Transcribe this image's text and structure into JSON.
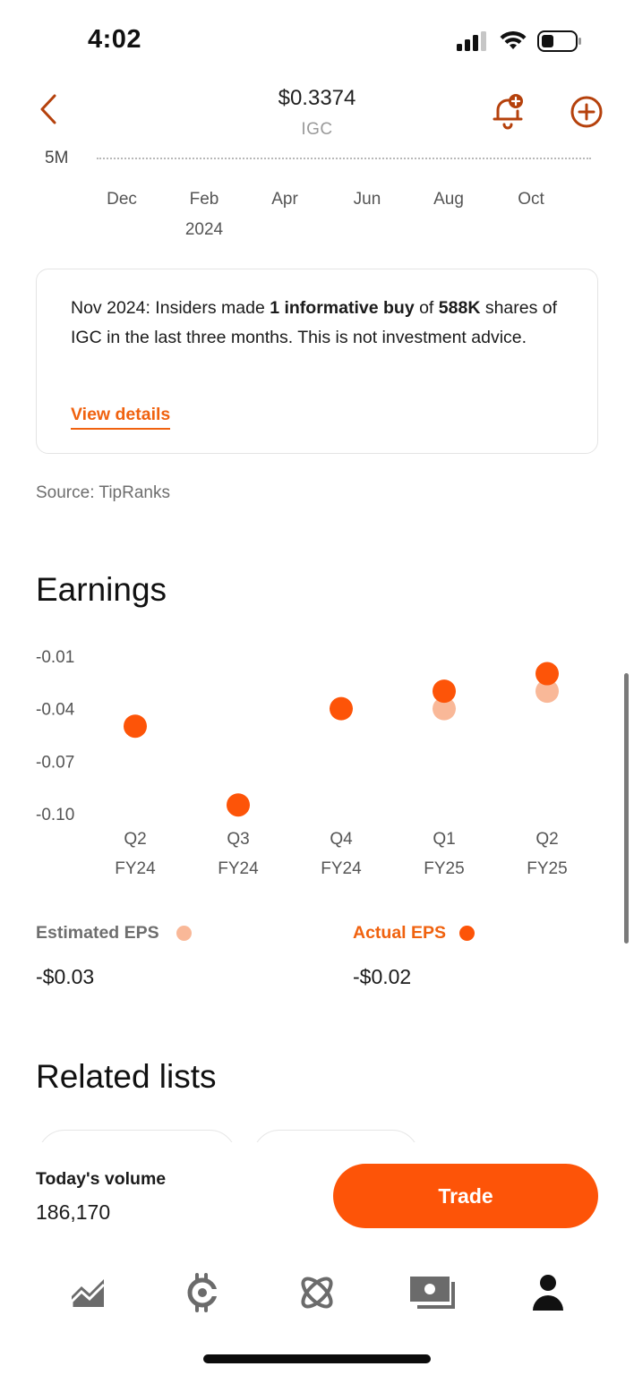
{
  "status_bar": {
    "time": "4:02"
  },
  "header": {
    "price": "$0.3374",
    "ticker": "IGC"
  },
  "volume_chart": {
    "y_label": "5M",
    "months": [
      "Dec",
      "Feb",
      "Apr",
      "Jun",
      "Aug",
      "Oct"
    ],
    "year_label": "2024"
  },
  "insider_card": {
    "text_1": "Nov 2024: Insiders made ",
    "bold_1": "1 informative buy",
    "text_2": " of ",
    "bold_2": "588K",
    "text_3": " shares of IGC in the last three months. This is not investment advice.",
    "link_label": "View details"
  },
  "source": "Source: TipRanks",
  "earnings": {
    "title": "Earnings",
    "estimated_label": "Estimated EPS",
    "actual_label": "Actual EPS",
    "estimated_value": "-$0.03",
    "actual_value": "-$0.02"
  },
  "chart_data": {
    "type": "scatter",
    "title": "Earnings",
    "y_ticks": [
      "-0.01",
      "-0.04",
      "-0.07",
      "-0.10"
    ],
    "ylim": [
      -0.1,
      -0.01
    ],
    "categories": [
      {
        "q": "Q2",
        "fy": "FY24"
      },
      {
        "q": "Q3",
        "fy": "FY24"
      },
      {
        "q": "Q4",
        "fy": "FY24"
      },
      {
        "q": "Q1",
        "fy": "FY25"
      },
      {
        "q": "Q2",
        "fy": "FY25"
      }
    ],
    "series": [
      {
        "name": "Estimated EPS",
        "color": "#f9b898",
        "values": [
          null,
          null,
          null,
          -0.04,
          -0.03
        ]
      },
      {
        "name": "Actual EPS",
        "color": "#fd5408",
        "values": [
          -0.05,
          -0.095,
          -0.04,
          -0.03,
          -0.02
        ]
      }
    ]
  },
  "related_lists": {
    "title": "Related lists"
  },
  "bottom": {
    "volume_title": "Today's volume",
    "volume_value": "186,170",
    "trade_label": "Trade"
  },
  "nav": [
    {
      "icon": "chart-icon"
    },
    {
      "icon": "crypto-icon"
    },
    {
      "icon": "orbit-icon"
    },
    {
      "icon": "cash-icon"
    },
    {
      "icon": "profile-icon"
    }
  ],
  "colors": {
    "accent": "#fd5408",
    "accent_text": "#f0620f",
    "accent_light": "#f9b898",
    "header_icon": "#b5410c"
  }
}
